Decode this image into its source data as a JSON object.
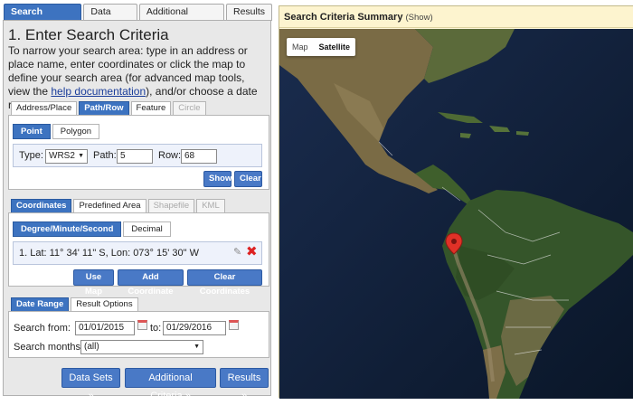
{
  "main_tabs": [
    {
      "label": "Search Criteria",
      "active": true
    },
    {
      "label": "Data Sets",
      "active": false
    },
    {
      "label": "Additional Criteria",
      "active": false
    },
    {
      "label": "Results",
      "active": false
    }
  ],
  "step_title": "1. Enter Search Criteria",
  "intro": {
    "before_link": "To narrow your search area: type in an address or place name, enter coordinates or click the map to define your search area (for advanced map tools, view the",
    "link": "help documentation",
    "after_link": "), and/or choose a date range."
  },
  "area_tabs": [
    {
      "label": "Address/Place",
      "state": "normal"
    },
    {
      "label": "Path/Row",
      "state": "active"
    },
    {
      "label": "Feature",
      "state": "normal"
    },
    {
      "label": "Circle",
      "state": "disabled"
    }
  ],
  "pathrow": {
    "mode_tabs": [
      {
        "label": "Point",
        "active": true
      },
      {
        "label": "Polygon",
        "active": false
      }
    ],
    "type_label": "Type:",
    "type_value": "WRS2",
    "path_label": "Path:",
    "path_value": "5",
    "row_label": "Row:",
    "row_value": "68",
    "show_button": "Show",
    "clear_button": "Clear"
  },
  "coord_tabs": [
    {
      "label": "Coordinates",
      "state": "active"
    },
    {
      "label": "Predefined Area",
      "state": "normal"
    },
    {
      "label": "Shapefile",
      "state": "disabled"
    },
    {
      "label": "KML",
      "state": "disabled"
    }
  ],
  "coordinates": {
    "format_tabs": [
      {
        "label": "Degree/Minute/Second",
        "active": true
      },
      {
        "label": "Decimal",
        "active": false
      }
    ],
    "entry": "1.  Lat: 11° 34' 11\" S, Lon: 073° 15' 30\" W",
    "use_map_button": "Use Map",
    "add_button": "Add Coordinate",
    "clear_button": "Clear Coordinates"
  },
  "date_tabs": [
    {
      "label": "Date Range",
      "state": "active"
    },
    {
      "label": "Result Options",
      "state": "normal"
    }
  ],
  "dates": {
    "from_label": "Search from:",
    "from_value": "01/01/2015",
    "to_label": "to:",
    "to_value": "01/29/2016",
    "months_label": "Search months:",
    "months_value": "(all)"
  },
  "nav_buttons": {
    "data_sets": "Data Sets »",
    "additional": "Additional Criteria »",
    "results": "Results »"
  },
  "summary": {
    "title": "Search Criteria Summary",
    "show": "(Show)"
  },
  "map": {
    "type_buttons": [
      {
        "label": "Map",
        "active": false
      },
      {
        "label": "Satellite",
        "active": true
      }
    ],
    "marker": "map-marker"
  },
  "colors": {
    "accent": "#3d73c0",
    "summary_bg": "#fdf4cf",
    "marker": "#e03127"
  }
}
